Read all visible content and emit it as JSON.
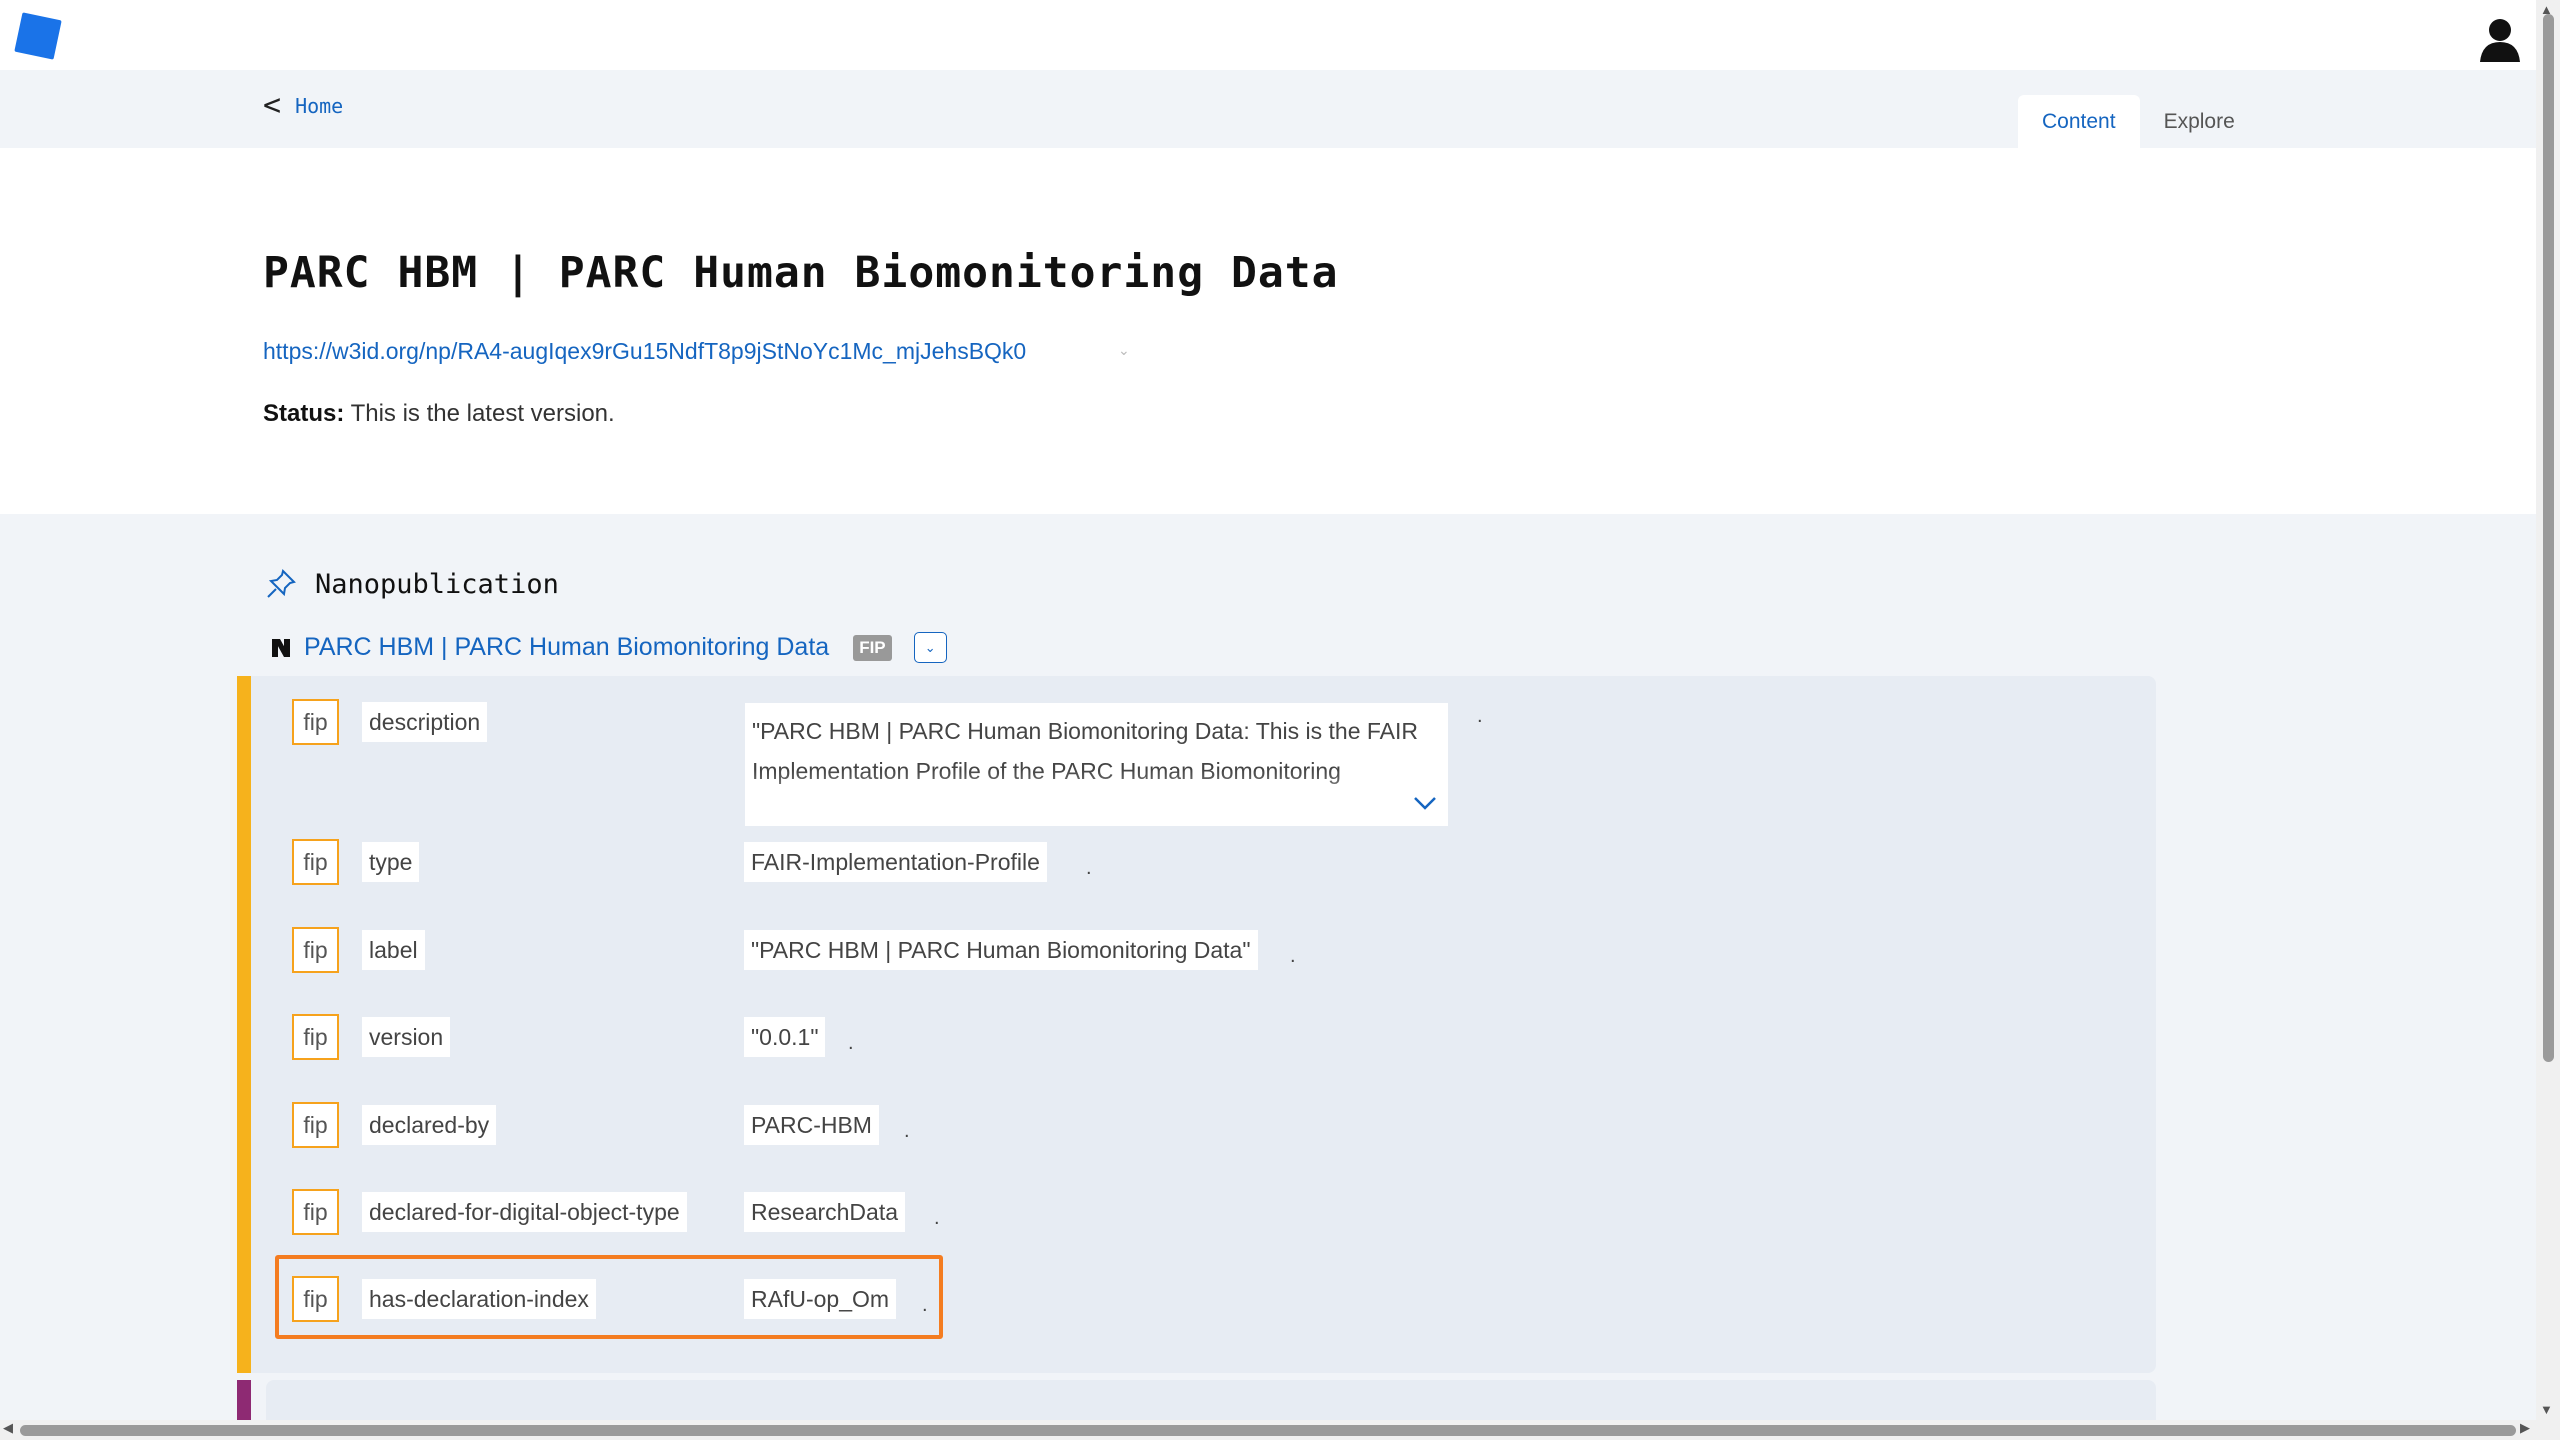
{
  "header": {
    "logo_icon": "nanopub-logo-icon",
    "avatar_icon": "user-avatar-icon",
    "brand_color": "#1a73e8"
  },
  "nav": {
    "back_label": "Home",
    "tabs": [
      {
        "label": "Content",
        "active": true
      },
      {
        "label": "Explore",
        "active": false
      }
    ]
  },
  "page": {
    "title": "PARC HBM | PARC Human Biomonitoring Data",
    "url": "https://w3id.org/np/RA4-augIqex9rGu15NdfT8p9jStNoYc1Mc_mjJehsBQk0",
    "status_label": "Status:",
    "status_text": "This is the latest version."
  },
  "nanopub": {
    "section_label": "Nanopublication",
    "section_icon": "pin-icon",
    "fip_title": "PARC HBM | PARC Human Biomonitoring Data",
    "badge": "FIP",
    "assertion_color": "#f6b21c",
    "provenance_color": "#8e2a73",
    "statements": [
      {
        "subject": "fip",
        "predicate": "description",
        "object": "\"PARC HBM | PARC Human Biomonitoring Data: This is the FAIR Implementation Profile of the PARC Human Biomonitoring",
        "dot": "."
      },
      {
        "subject": "fip",
        "predicate": "type",
        "object": "FAIR-Implementation-Profile",
        "dot": "."
      },
      {
        "subject": "fip",
        "predicate": "label",
        "object": "\"PARC HBM | PARC Human Biomonitoring Data\"",
        "dot": "."
      },
      {
        "subject": "fip",
        "predicate": "version",
        "object": "\"0.0.1\"",
        "dot": "."
      },
      {
        "subject": "fip",
        "predicate": "declared-by",
        "object": "PARC-HBM",
        "dot": "."
      },
      {
        "subject": "fip",
        "predicate": "declared-for-digital-object-type",
        "object": "ResearchData",
        "dot": "."
      },
      {
        "subject": "fip",
        "predicate": "has-declaration-index",
        "object": "RAfU-op_Om",
        "dot": "."
      }
    ]
  }
}
